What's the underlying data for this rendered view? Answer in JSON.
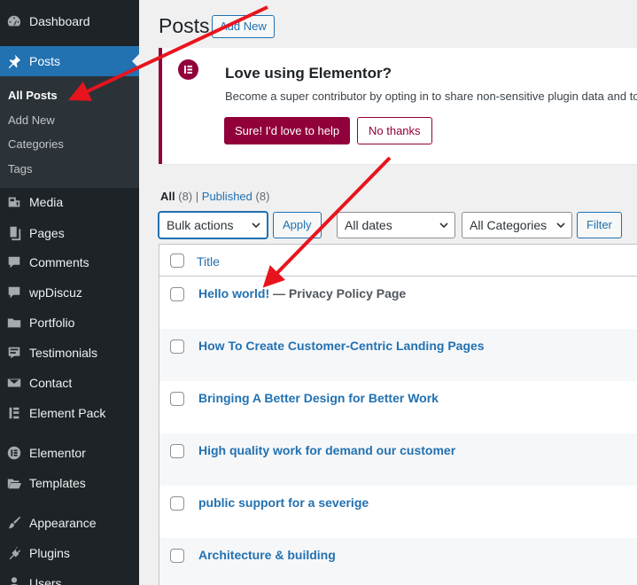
{
  "sidebar": {
    "items": [
      {
        "label": "Dashboard",
        "icon": "dashboard-icon"
      },
      {
        "label": "Posts",
        "icon": "pushpin-icon"
      },
      {
        "label": "Media",
        "icon": "media-icon"
      },
      {
        "label": "Pages",
        "icon": "pages-icon"
      },
      {
        "label": "Comments",
        "icon": "comments-icon"
      },
      {
        "label": "wpDiscuz",
        "icon": "comments-icon"
      },
      {
        "label": "Portfolio",
        "icon": "folder-icon"
      },
      {
        "label": "Testimonials",
        "icon": "testimonial-icon"
      },
      {
        "label": "Contact",
        "icon": "envelope-icon"
      },
      {
        "label": "Element Pack",
        "icon": "element-pack-icon"
      },
      {
        "label": "Elementor",
        "icon": "elementor-icon"
      },
      {
        "label": "Templates",
        "icon": "folder-open-icon"
      },
      {
        "label": "Appearance",
        "icon": "paintbrush-icon"
      },
      {
        "label": "Plugins",
        "icon": "plugin-icon"
      },
      {
        "label": "Users",
        "icon": "users-icon"
      }
    ],
    "submenu": [
      "All Posts",
      "Add New",
      "Categories",
      "Tags"
    ]
  },
  "header": {
    "title": "Posts",
    "add_new": "Add New"
  },
  "notice": {
    "title": "Love using Elementor?",
    "description": "Become a super contributor by opting in to share non-sensitive plugin data and to",
    "primary_button": "Sure! I'd love to help",
    "secondary_button": "No thanks",
    "accent_color": "#92003b"
  },
  "filters": {
    "all_label": "All",
    "all_count": "(8)",
    "separator": "|",
    "published_label": "Published",
    "published_count": "(8)",
    "bulk_actions": "Bulk actions",
    "apply": "Apply",
    "dates": "All dates",
    "categories": "All Categories",
    "filter": "Filter"
  },
  "table": {
    "column_title": "Title",
    "rows": [
      {
        "title": "Hello world!",
        "state": " — Privacy Policy Page"
      },
      {
        "title": "How To Create Customer-Centric Landing Pages",
        "state": ""
      },
      {
        "title": "Bringing A Better Design for Better Work",
        "state": ""
      },
      {
        "title": "High quality work for demand our customer",
        "state": ""
      },
      {
        "title": "public support for a severige",
        "state": ""
      },
      {
        "title": "Architecture & building",
        "state": ""
      }
    ]
  },
  "colors": {
    "admin_dark": "#1d2327",
    "accent_blue": "#2271b1",
    "annotation_red": "#e8141d"
  }
}
